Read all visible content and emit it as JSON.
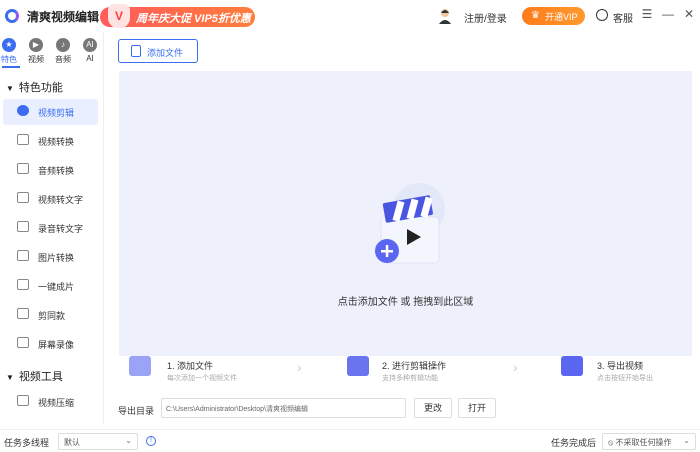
{
  "titlebar": {
    "app_title": "清爽视频编辑",
    "promo_badge": "V",
    "promo_text": "周年庆大促 VIP5折优惠",
    "login": "注册/登录",
    "vip_button": "开通VIP",
    "service": "客服",
    "controls": [
      "☰",
      "—",
      "✕"
    ]
  },
  "sidebar": {
    "categories": [
      {
        "label": "特色",
        "icon": "star-icon",
        "glyph": "★",
        "active": true
      },
      {
        "label": "视频",
        "icon": "video-icon",
        "glyph": "▶",
        "active": false
      },
      {
        "label": "音频",
        "icon": "audio-icon",
        "glyph": "♪",
        "active": false
      },
      {
        "label": "AI",
        "icon": "ai-icon",
        "glyph": "AI",
        "active": false
      }
    ],
    "section1": "特色功能",
    "items": [
      {
        "label": "视频剪辑",
        "icon": "video-edit-icon",
        "active": true
      },
      {
        "label": "视频转换",
        "icon": "video-convert-icon"
      },
      {
        "label": "音频转换",
        "icon": "audio-convert-icon"
      },
      {
        "label": "视频转文字",
        "icon": "video-to-text-icon"
      },
      {
        "label": "录音转文字",
        "icon": "audio-to-text-icon"
      },
      {
        "label": "图片转换",
        "icon": "image-convert-icon"
      },
      {
        "label": "一键成片",
        "icon": "one-click-icon"
      },
      {
        "label": "剪同款",
        "icon": "template-icon"
      },
      {
        "label": "屏幕录像",
        "icon": "screen-record-icon"
      }
    ],
    "section2": "视频工具",
    "tools": [
      {
        "label": "视频压缩",
        "icon": "video-compress-icon"
      }
    ]
  },
  "main": {
    "add_file": "添加文件",
    "drop_text": "点击添加文件 或 拖拽到此区域",
    "steps": [
      {
        "title": "1. 添加文件",
        "desc": "每次添加一个视频文件"
      },
      {
        "title": "2. 进行剪辑操作",
        "desc": "支持多种剪辑功能"
      },
      {
        "title": "3. 导出视频",
        "desc": "点击按钮开始导出"
      }
    ],
    "export_label": "导出目录",
    "export_path": "C:\\Users\\Administrator\\Desktop\\清爽视频编辑",
    "change_button": "更改",
    "open_button": "打开"
  },
  "bottombar": {
    "threads_label": "任务多线程",
    "threads_value": "默认",
    "after_label": "任务完成后",
    "after_value": "不采取任何操作"
  },
  "colors": {
    "accent": "#3a6df0",
    "promo": "#ff5b5b",
    "vip": "#ff8a26",
    "dropzone_bg": "#eef1fb"
  }
}
